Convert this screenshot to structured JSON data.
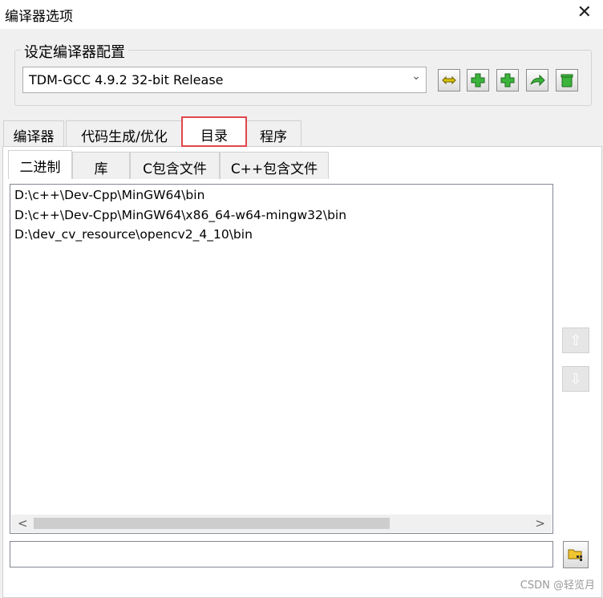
{
  "window": {
    "title": "编译器选项",
    "close_glyph": "✕"
  },
  "config_group": {
    "label": "设定编译器配置",
    "selected_config": "TDM-GCC 4.9.2 32-bit Release",
    "buttons": [
      "compile-settings-icon",
      "add-icon",
      "add-icon",
      "rename-icon",
      "delete-icon"
    ]
  },
  "tabs": [
    "编译器",
    "代码生成/优化",
    "目录",
    "程序"
  ],
  "active_tab": "目录",
  "inner_tabs": [
    "二进制",
    "库",
    "C包含文件",
    "C++包含文件"
  ],
  "active_inner_tab": "二进制",
  "directories": [
    "D:\\c++\\Dev-Cpp\\MinGW64\\bin",
    "D:\\c++\\Dev-Cpp\\MinGW64\\x86_64-w64-mingw32\\bin",
    "D:\\dev_cv_resource\\opencv2_4_10\\bin"
  ],
  "scroll": {
    "left": "<",
    "right": ">",
    "up": "⇧",
    "down": "⇩"
  },
  "path_input": {
    "value": ""
  },
  "watermark": "CSDN @轻览月"
}
